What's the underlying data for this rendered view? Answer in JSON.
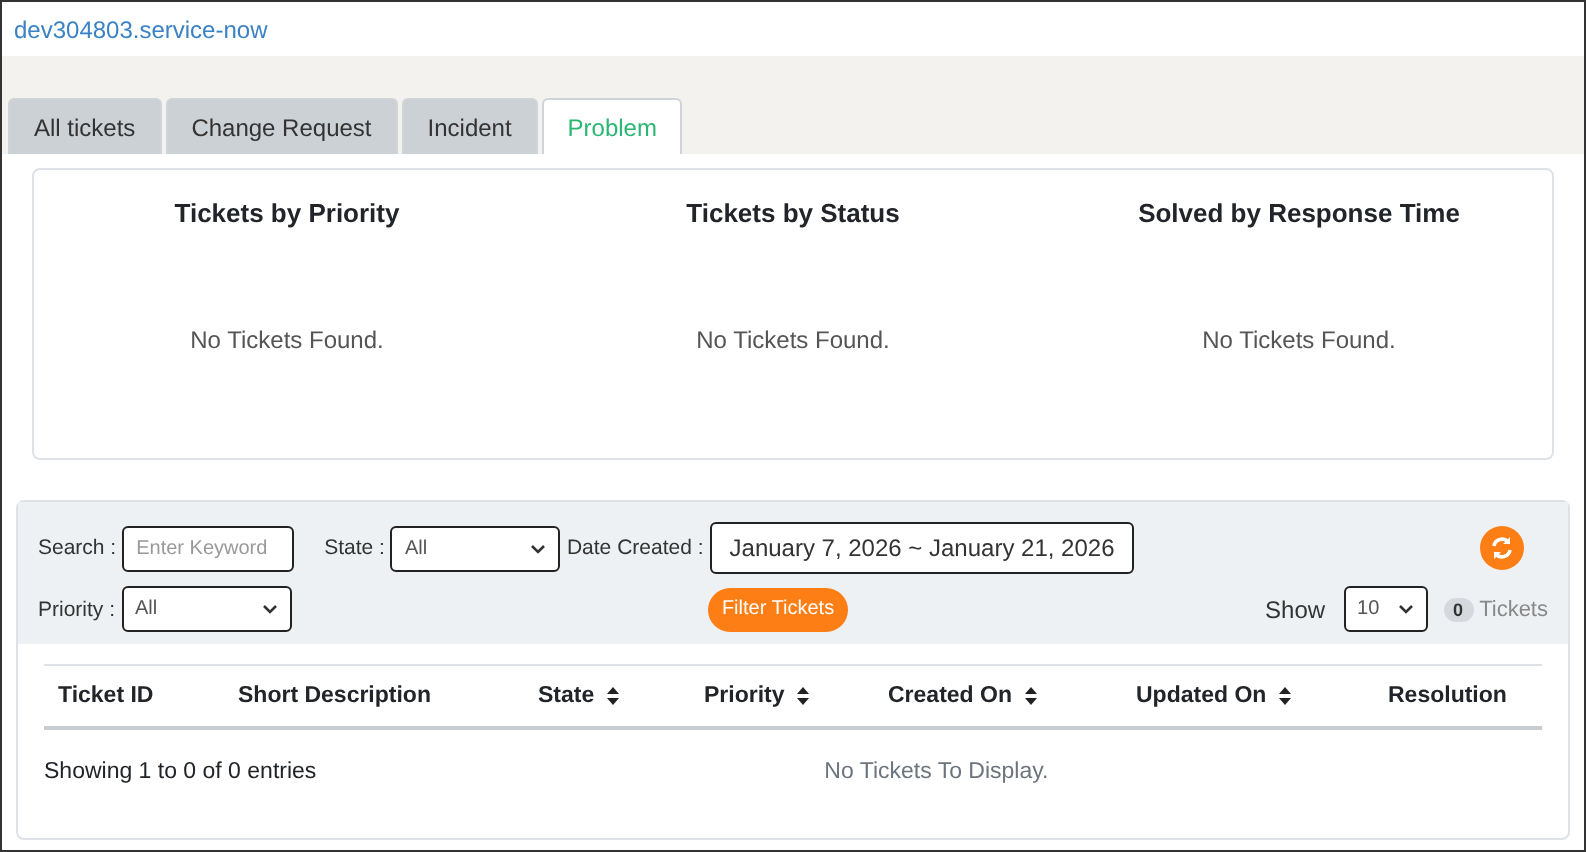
{
  "site_link": "dev304803.service-now",
  "tabs": [
    {
      "label": "All tickets",
      "selected": false
    },
    {
      "label": "Change Request",
      "selected": false
    },
    {
      "label": "Incident",
      "selected": false
    },
    {
      "label": "Problem",
      "selected": true
    }
  ],
  "charts": [
    {
      "title": "Tickets by Priority",
      "message": "No Tickets Found."
    },
    {
      "title": "Tickets by Status",
      "message": "No Tickets Found."
    },
    {
      "title": "Solved by Response Time",
      "message": "No Tickets Found."
    }
  ],
  "filters": {
    "search_label": "Search :",
    "search_placeholder": "Enter Keyword",
    "state_label": "State :",
    "state_value": "All",
    "date_label": "Date Created :",
    "date_value": "January 7, 2026 ~ January 21, 2026",
    "priority_label": "Priority :",
    "priority_value": "All",
    "filter_button": "Filter Tickets",
    "show_label": "Show",
    "show_value": "10",
    "ticket_count": "0",
    "tickets_label": "Tickets"
  },
  "table": {
    "columns": [
      {
        "label": "Ticket ID",
        "sortable": false
      },
      {
        "label": "Short Description",
        "sortable": false
      },
      {
        "label": "State",
        "sortable": true
      },
      {
        "label": "Priority",
        "sortable": true
      },
      {
        "label": "Created On",
        "sortable": true
      },
      {
        "label": "Updated On",
        "sortable": true
      },
      {
        "label": "Resolution",
        "sortable": false
      }
    ],
    "entries_info": "Showing 1 to 0 of 0 entries",
    "empty_message": "No Tickets To Display."
  }
}
